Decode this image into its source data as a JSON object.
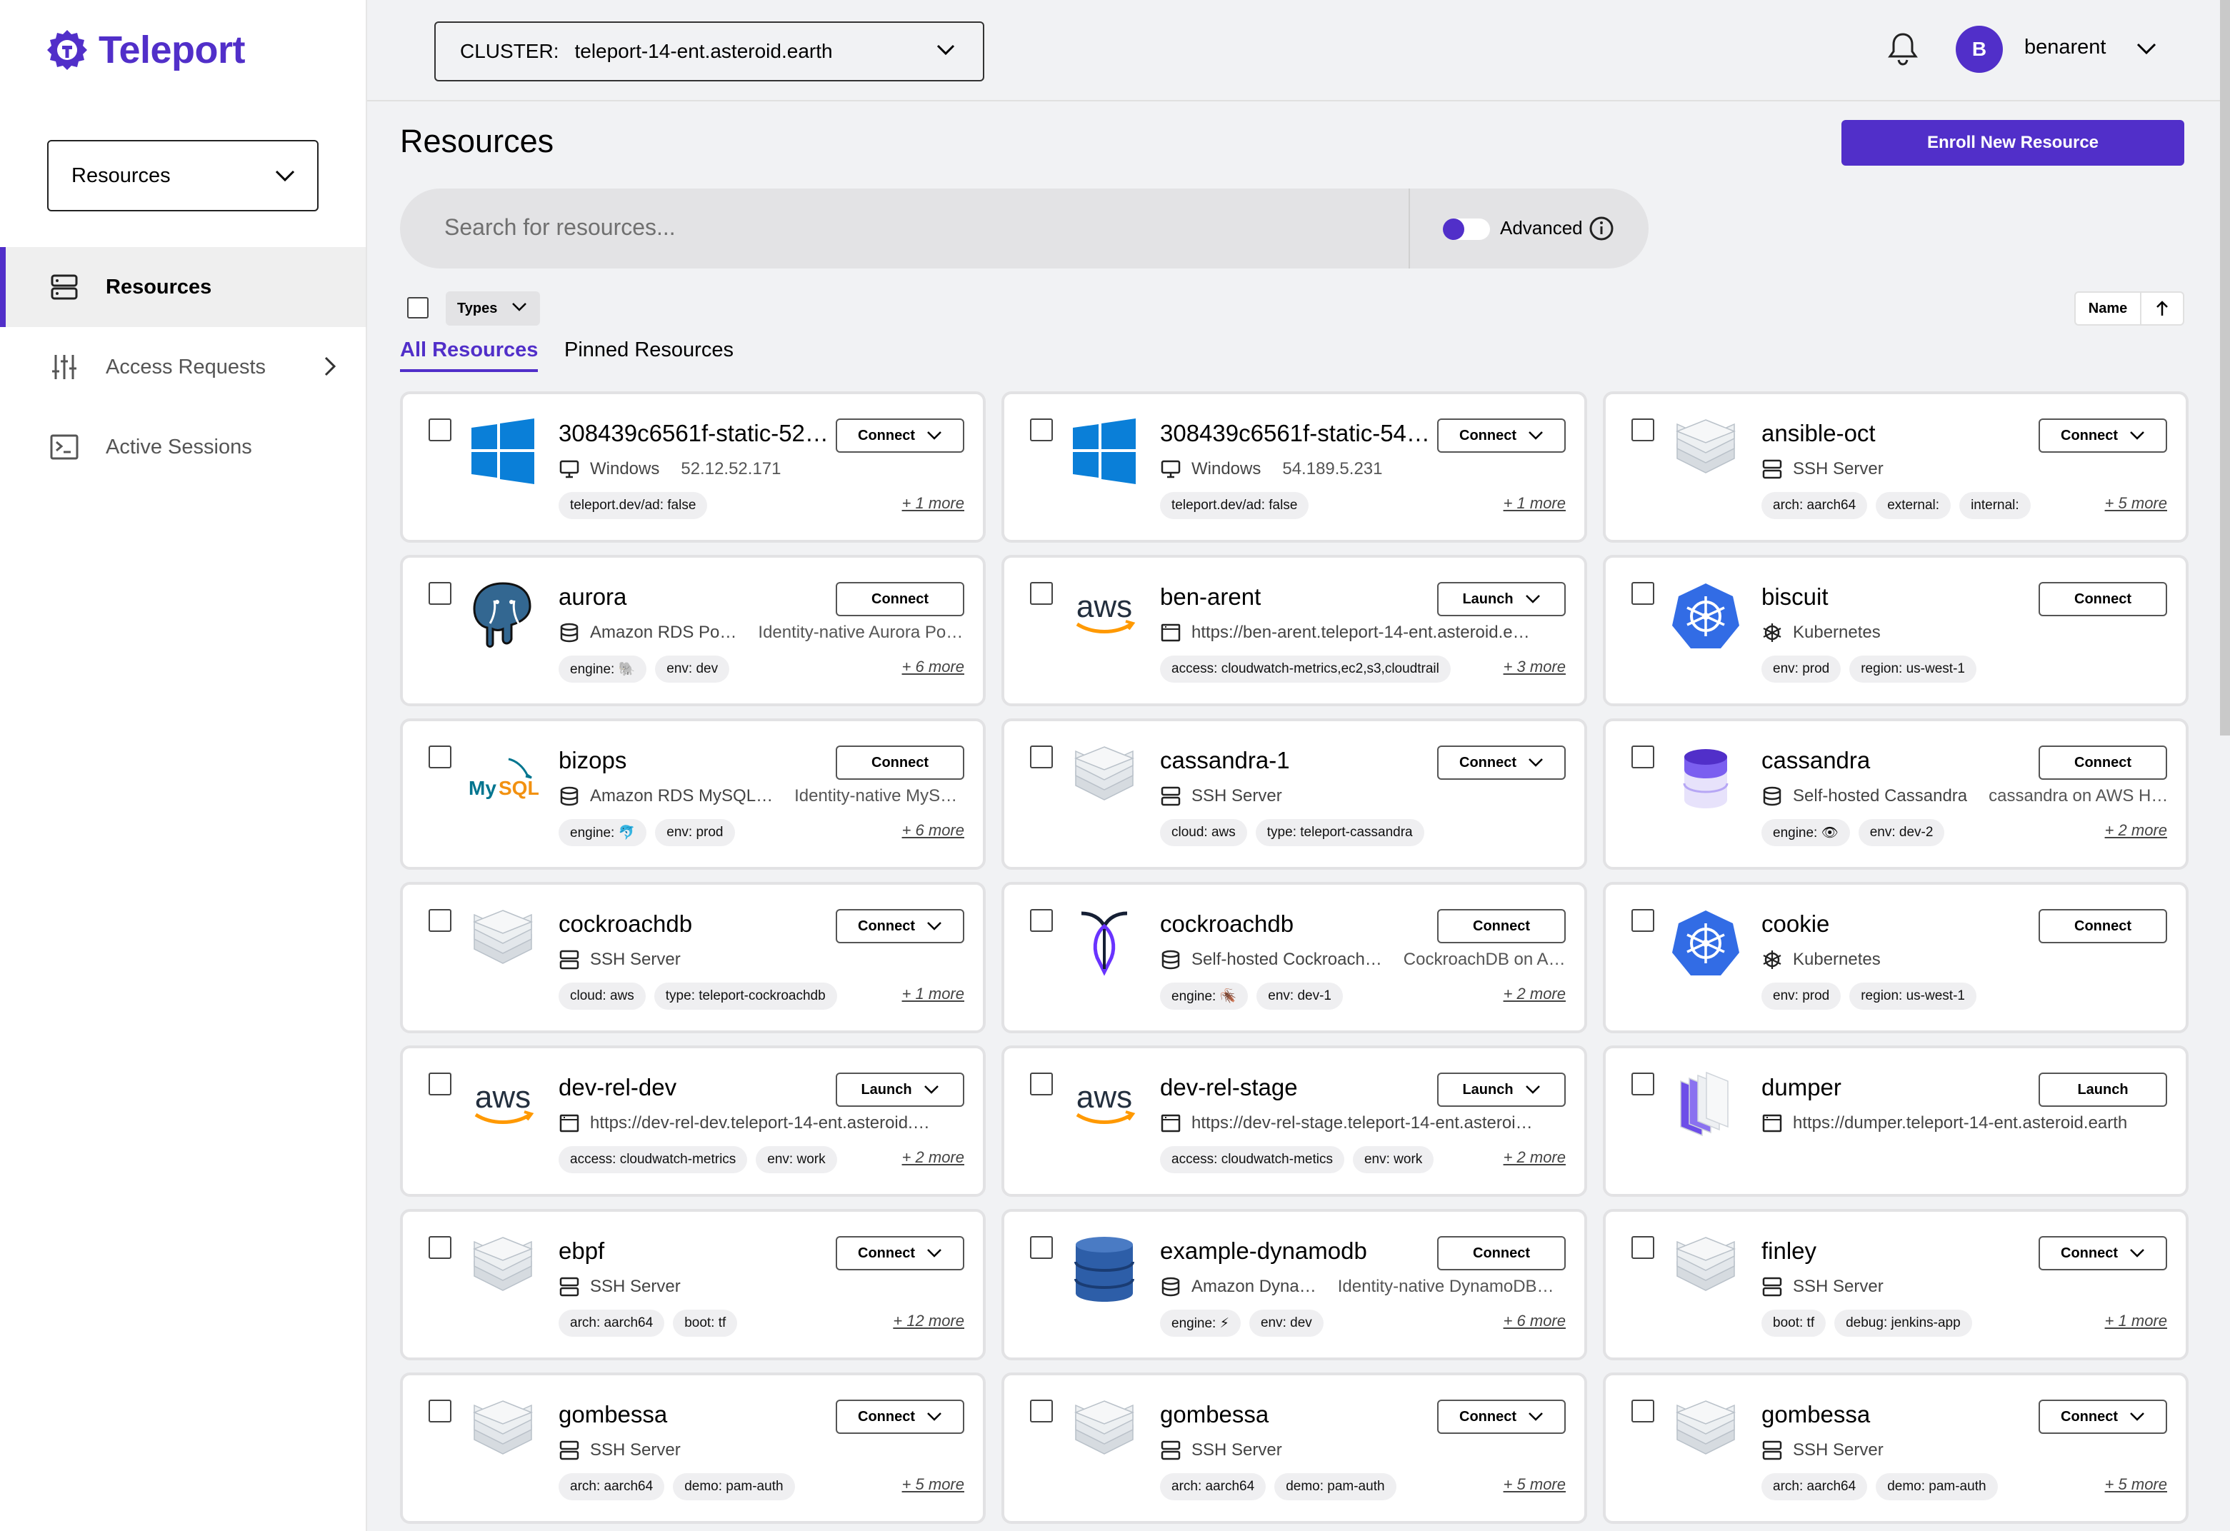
{
  "brand": {
    "name": "Teleport",
    "color": "#512fc9"
  },
  "sidebar": {
    "select_label": "Resources",
    "items": [
      {
        "label": "Resources",
        "icon": "server-icon",
        "active": true
      },
      {
        "label": "Access Requests",
        "icon": "sliders-icon",
        "active": false
      },
      {
        "label": "Active Sessions",
        "icon": "terminal-icon",
        "active": false
      }
    ]
  },
  "header": {
    "cluster_prefix": "CLUSTER:",
    "cluster_value": "teleport-14-ent.asteroid.earth",
    "avatar_initial": "B",
    "username": "benarent"
  },
  "page": {
    "title": "Resources",
    "enroll_button": "Enroll New Resource",
    "search_placeholder": "Search for resources...",
    "advanced_label": "Advanced",
    "types_label": "Types",
    "sort_label": "Name",
    "tabs": [
      "All Resources",
      "Pinned Resources"
    ]
  },
  "resources": [
    {
      "name": "308439c6561f-static-52-…",
      "icon": "windows-logo-icon",
      "button": "Connect",
      "dropdown": true,
      "type_icon": "desktop-icon",
      "type": "Windows",
      "detail": "52.12.52.171",
      "labels": [
        "teleport.dev/ad: false"
      ],
      "more": "+ 1 more"
    },
    {
      "name": "308439c6561f-static-54-…",
      "icon": "windows-logo-icon",
      "button": "Connect",
      "dropdown": true,
      "type_icon": "desktop-icon",
      "type": "Windows",
      "detail": "54.189.5.231",
      "labels": [
        "teleport.dev/ad: false"
      ],
      "more": "+ 1 more"
    },
    {
      "name": "ansible-oct",
      "icon": "server-stack-icon",
      "button": "Connect",
      "dropdown": true,
      "type_icon": "server-icon",
      "type": "SSH Server",
      "detail": "",
      "labels": [
        "arch: aarch64",
        "external:",
        "internal:"
      ],
      "more": "+ 5 more"
    },
    {
      "name": "aurora",
      "icon": "postgres-elephant-icon",
      "button": "Connect",
      "dropdown": false,
      "type_icon": "database-icon",
      "type": "Amazon RDS Po…",
      "detail": "Identity-native Aurora Po…",
      "labels": [
        "engine: 🐘",
        "env: dev"
      ],
      "more": "+ 6 more"
    },
    {
      "name": "ben-arent",
      "icon": "aws-logo-icon",
      "button": "Launch",
      "dropdown": true,
      "type_icon": "app-window-icon",
      "type": "https://ben-arent.teleport-14-ent.asteroid.e…",
      "detail": "",
      "labels": [
        "access: cloudwatch-metrics,ec2,s3,cloudtrail"
      ],
      "more": "+ 3 more"
    },
    {
      "name": "biscuit",
      "icon": "kubernetes-logo-icon",
      "button": "Connect",
      "dropdown": false,
      "type_icon": "kubernetes-icon",
      "type": "Kubernetes",
      "detail": "",
      "labels": [
        "env: prod",
        "region: us-west-1"
      ],
      "more": ""
    },
    {
      "name": "bizops",
      "icon": "mysql-logo-icon",
      "button": "Connect",
      "dropdown": false,
      "type_icon": "database-icon",
      "type": "Amazon RDS MySQL…",
      "detail": "Identity-native MyS…",
      "labels": [
        "engine: 🐬",
        "env: prod"
      ],
      "more": "+ 6 more"
    },
    {
      "name": "cassandra-1",
      "icon": "server-stack-icon",
      "button": "Connect",
      "dropdown": true,
      "type_icon": "server-icon",
      "type": "SSH Server",
      "detail": "",
      "labels": [
        "cloud: aws",
        "type: teleport-cassandra"
      ],
      "more": ""
    },
    {
      "name": "cassandra",
      "icon": "database-cylinder-icon",
      "button": "Connect",
      "dropdown": false,
      "type_icon": "database-icon",
      "type": "Self-hosted Cassandra",
      "detail": "cassandra on AWS Host",
      "labels": [
        "engine: 👁",
        "env: dev-2"
      ],
      "more": "+ 2 more"
    },
    {
      "name": "cockroachdb",
      "icon": "server-stack-icon",
      "button": "Connect",
      "dropdown": true,
      "type_icon": "server-icon",
      "type": "SSH Server",
      "detail": "",
      "labels": [
        "cloud: aws",
        "type: teleport-cockroachdb"
      ],
      "more": "+ 1 more"
    },
    {
      "name": "cockroachdb",
      "icon": "cockroach-logo-icon",
      "button": "Connect",
      "dropdown": false,
      "type_icon": "database-icon",
      "type": "Self-hosted Cockroach…",
      "detail": "CockroachDB on A…",
      "labels": [
        "engine: 🪳",
        "env: dev-1"
      ],
      "more": "+ 2 more"
    },
    {
      "name": "cookie",
      "icon": "kubernetes-logo-icon",
      "button": "Connect",
      "dropdown": false,
      "type_icon": "kubernetes-icon",
      "type": "Kubernetes",
      "detail": "",
      "labels": [
        "env: prod",
        "region: us-west-1"
      ],
      "more": ""
    },
    {
      "name": "dev-rel-dev",
      "icon": "aws-logo-icon",
      "button": "Launch",
      "dropdown": true,
      "type_icon": "app-window-icon",
      "type": "https://dev-rel-dev.teleport-14-ent.asteroid.…",
      "detail": "",
      "labels": [
        "access: cloudwatch-metrics",
        "env: work"
      ],
      "more": "+ 2 more"
    },
    {
      "name": "dev-rel-stage",
      "icon": "aws-logo-icon",
      "button": "Launch",
      "dropdown": true,
      "type_icon": "app-window-icon",
      "type": "https://dev-rel-stage.teleport-14-ent.asteroi…",
      "detail": "",
      "labels": [
        "access: cloudwatch-metics",
        "env: work"
      ],
      "more": "+ 2 more"
    },
    {
      "name": "dumper",
      "icon": "app-stack-icon",
      "button": "Launch",
      "dropdown": false,
      "type_icon": "app-window-icon",
      "type": "https://dumper.teleport-14-ent.asteroid.earth",
      "detail": "",
      "labels": [],
      "more": ""
    },
    {
      "name": "ebpf",
      "icon": "server-stack-icon",
      "button": "Connect",
      "dropdown": true,
      "type_icon": "server-icon",
      "type": "SSH Server",
      "detail": "",
      "labels": [
        "arch: aarch64",
        "boot: tf"
      ],
      "more": "+ 12 more"
    },
    {
      "name": "example-dynamodb",
      "icon": "dynamodb-logo-icon",
      "button": "Connect",
      "dropdown": false,
      "type_icon": "database-icon",
      "type": "Amazon Dyna…",
      "detail": "Identity-native DynamoDB…",
      "labels": [
        "engine: ⚡",
        "env: dev"
      ],
      "more": "+ 6 more"
    },
    {
      "name": "finley",
      "icon": "server-stack-icon",
      "button": "Connect",
      "dropdown": true,
      "type_icon": "server-icon",
      "type": "SSH Server",
      "detail": "",
      "labels": [
        "boot: tf",
        "debug: jenkins-app"
      ],
      "more": "+ 1 more"
    },
    {
      "name": "gombessa",
      "icon": "server-stack-icon",
      "button": "Connect",
      "dropdown": true,
      "type_icon": "server-icon",
      "type": "SSH Server",
      "detail": "",
      "labels": [
        "arch: aarch64",
        "demo: pam-auth"
      ],
      "more": "+ 5 more"
    },
    {
      "name": "gombessa",
      "icon": "server-stack-icon",
      "button": "Connect",
      "dropdown": true,
      "type_icon": "server-icon",
      "type": "SSH Server",
      "detail": "",
      "labels": [
        "arch: aarch64",
        "demo: pam-auth"
      ],
      "more": "+ 5 more"
    },
    {
      "name": "gombessa",
      "icon": "server-stack-icon",
      "button": "Connect",
      "dropdown": true,
      "type_icon": "server-icon",
      "type": "SSH Server",
      "detail": "",
      "labels": [
        "arch: aarch64",
        "demo: pam-auth"
      ],
      "more": "+ 5 more"
    }
  ]
}
